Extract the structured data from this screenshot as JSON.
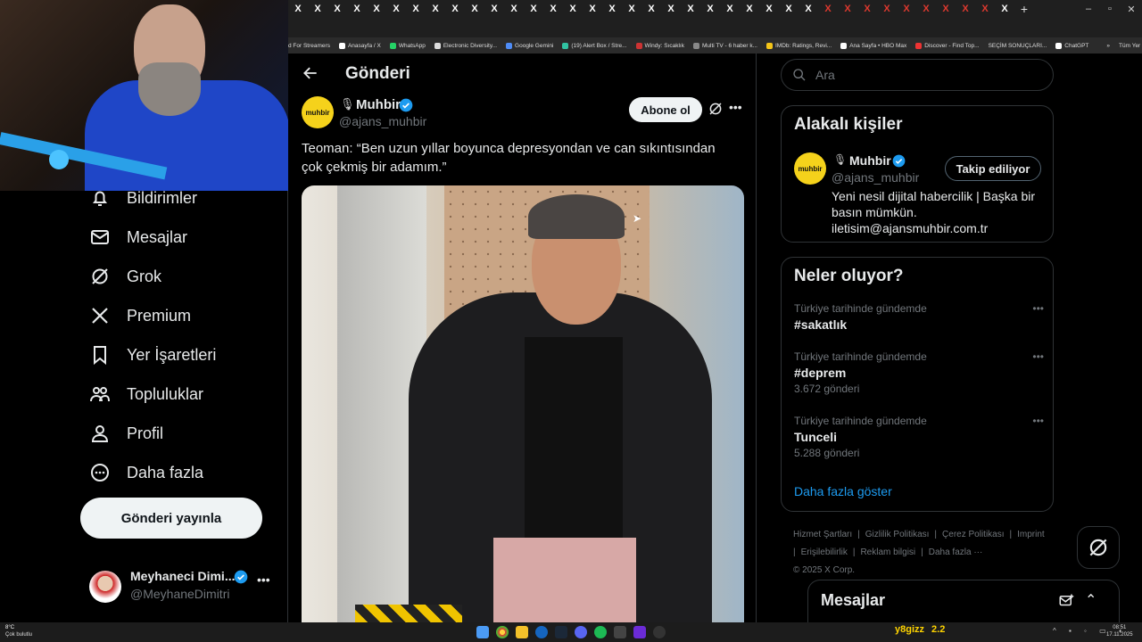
{
  "browser": {
    "tabs": [
      "X",
      "X",
      "X",
      "X",
      "X",
      "X",
      "X",
      "X",
      "X",
      "X",
      "X",
      "X",
      "X",
      "X",
      "X",
      "X",
      "X",
      "X",
      "X",
      "X",
      "X",
      "X",
      "X",
      "X",
      "X",
      "X",
      "X",
      "X",
      "X",
      "X",
      "X",
      "X",
      "X",
      "X",
      "X",
      "X",
      "X",
      "+"
    ],
    "bookmarks": [
      {
        "label": "d For Streamers",
        "color": ""
      },
      {
        "label": "Anasayfa / X",
        "color": "#ffffff"
      },
      {
        "label": "WhatsApp",
        "color": "#25d366"
      },
      {
        "label": "Electronic Diversity...",
        "color": "#dddddd"
      },
      {
        "label": "Google Gemini",
        "color": "#4e8cf7"
      },
      {
        "label": "(19) Alert Box / Stre...",
        "color": "#31c3a2"
      },
      {
        "label": "Windy: Sıcaklık",
        "color": "#c33"
      },
      {
        "label": "Multi TV - 6 haber k...",
        "color": "#888"
      },
      {
        "label": "IMDb: Ratings, Revi...",
        "color": "#f5c518"
      },
      {
        "label": "Ana Sayfa • HBO Max",
        "color": "#ffffff"
      },
      {
        "label": "Discover - Find Top...",
        "color": "#e33"
      },
      {
        "label": "SEÇİM SONUÇLARI...",
        "color": ""
      },
      {
        "label": "ChatGPT",
        "color": "#ffffff"
      }
    ],
    "bookmarks_more": "»",
    "all_bookmarks": "Tüm Yer İşaretleri"
  },
  "nav": {
    "items": [
      {
        "label": "Bildirimler",
        "icon": "bell-icon"
      },
      {
        "label": "Mesajlar",
        "icon": "mail-icon"
      },
      {
        "label": "Grok",
        "icon": "grok-icon"
      },
      {
        "label": "Premium",
        "icon": "x-logo-icon"
      },
      {
        "label": "Yer İşaretleri",
        "icon": "bookmark-icon"
      },
      {
        "label": "Topluluklar",
        "icon": "communities-icon"
      },
      {
        "label": "Profil",
        "icon": "profile-icon"
      },
      {
        "label": "Daha fazla",
        "icon": "more-circle-icon"
      }
    ],
    "post_button": "Gönderi yayınla",
    "account": {
      "name": "Meyhaneci Dimi...",
      "handle": "@MeyhaneDimitri"
    }
  },
  "main": {
    "title": "Gönderi",
    "post": {
      "author_name": "Muhbir",
      "author_handle": "@ajans_muhbir",
      "avatar_text": "muhbir",
      "subscribe_label": "Abone ol",
      "text": "Teoman: “Ben uzun yıllar boyunca depresyondan ve can sıkıntısından çok çekmiş bir adamım.”"
    }
  },
  "right": {
    "search_placeholder": "Ara",
    "related": {
      "title": "Alakalı kişiler",
      "name": "Muhbir",
      "handle": "@ajans_muhbir",
      "avatar_text": "muhbir",
      "follow_label": "Takip ediliyor",
      "bio": "Yeni nesil dijital habercilik | Başka bir basın mümkün. iletisim@ajansmuhbir.com.tr"
    },
    "trending": {
      "title": "Neler oluyor?",
      "items": [
        {
          "context": "Türkiye tarihinde gündemde",
          "tag": "#sakatlık",
          "count": ""
        },
        {
          "context": "Türkiye tarihinde gündemde",
          "tag": "#deprem",
          "count": "3.672 gönderi"
        },
        {
          "context": "Türkiye tarihinde gündemde",
          "tag": "Tunceli",
          "count": "5.288 gönderi"
        }
      ],
      "show_more": "Daha fazla göster"
    },
    "footer": [
      "Hizmet Şartları",
      "|",
      "Gizlilik Politikası",
      "|",
      "Çerez Politikası",
      "|",
      "Imprint",
      "|",
      "Erişilebilirlik",
      "|",
      "Reklam bilgisi",
      "|",
      "Daha fazla ···",
      "© 2025 X Corp."
    ]
  },
  "dm_drawer": {
    "title": "Mesajlar"
  },
  "taskbar": {
    "weather_temp": "8°C",
    "weather_desc": "Çok bulutlu",
    "hud_name": "y8gizz",
    "hud_value": "2.2",
    "time": "08:51",
    "date": "17.11.2025"
  },
  "colors": {
    "accent": "#1d9bf0",
    "verified": "#1d9bf0",
    "muhbir_yellow": "#f5d21b"
  }
}
